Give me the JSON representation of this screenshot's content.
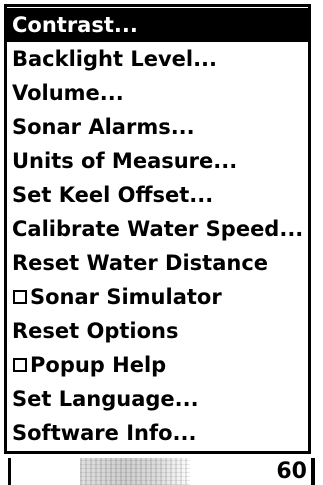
{
  "menu": {
    "items": [
      {
        "label": "Contrast...",
        "selected": true
      },
      {
        "label": "Backlight Level..."
      },
      {
        "label": "Volume..."
      },
      {
        "label": "Sonar Alarms..."
      },
      {
        "label": "Units of Measure..."
      },
      {
        "label": "Set Keel Offset..."
      },
      {
        "label": "Calibrate Water Speed..."
      },
      {
        "label": "Reset Water Distance"
      },
      {
        "label": "Sonar Simulator",
        "checkbox": true,
        "checked": false
      },
      {
        "label": "Reset Options"
      },
      {
        "label": "Popup Help",
        "checkbox": true,
        "checked": false
      },
      {
        "label": "Set Language..."
      },
      {
        "label": "Software Info..."
      }
    ]
  },
  "status": {
    "depth_scale": "60"
  },
  "colors": {
    "background": "#ffffff",
    "foreground": "#000000",
    "highlight": "#000000",
    "highlight_text": "#ffffff"
  }
}
